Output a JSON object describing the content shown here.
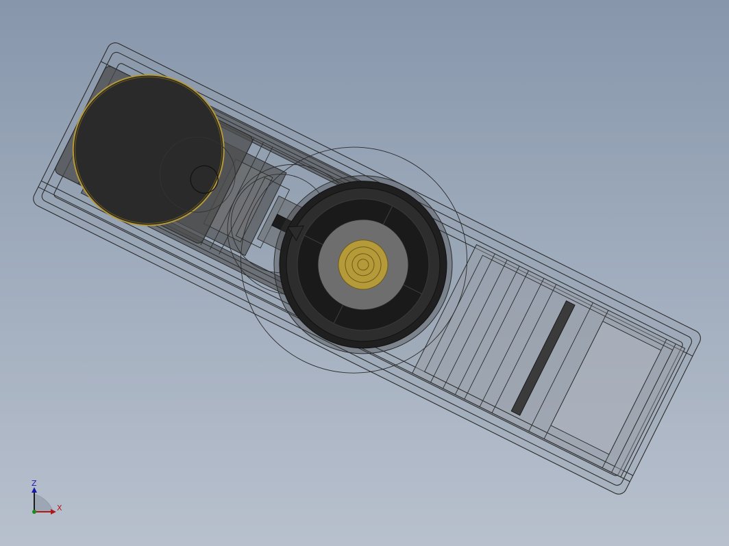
{
  "triad": {
    "z_label": "Z",
    "x_label": "X",
    "z_color": "#1a1aa6",
    "x_color": "#b01818",
    "origin_color": "#1c8a1c"
  },
  "colors": {
    "wireframe": "#2a2a2a",
    "body_fill": "#4a4a4a",
    "dark_fill": "#1e1e1e",
    "brass": "#b59a3a",
    "brass_dark": "#6d5a18"
  }
}
